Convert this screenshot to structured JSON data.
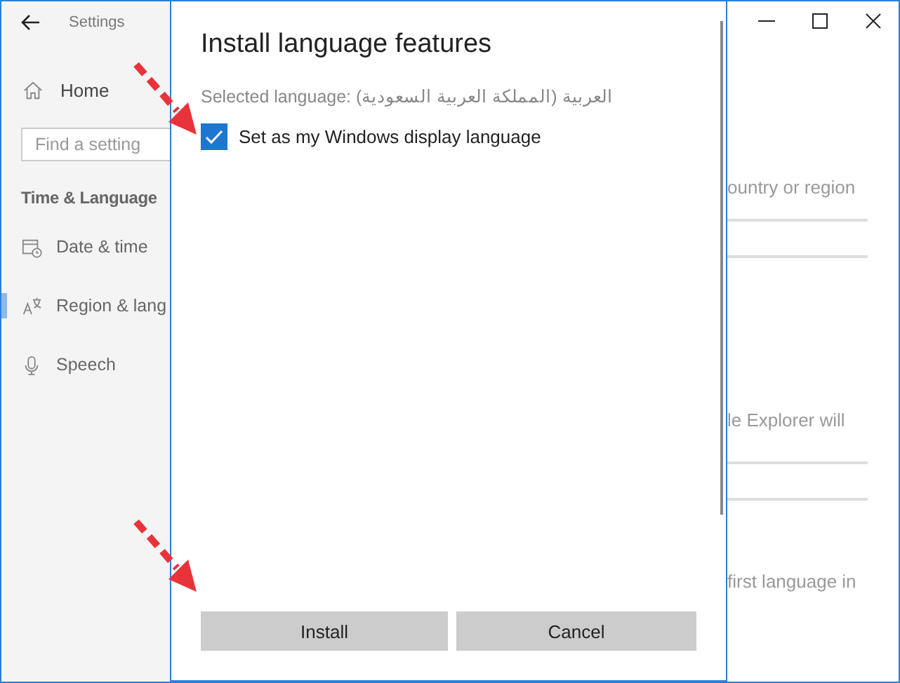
{
  "window": {
    "title": "Settings"
  },
  "sidebar": {
    "home": "Home",
    "search": {
      "placeholder": "Find a setting"
    },
    "section_title": "Time & Language",
    "items": [
      {
        "label": "Date & time",
        "selected": false
      },
      {
        "label": "Region & lang",
        "selected": true
      },
      {
        "label": "Speech",
        "selected": false
      }
    ]
  },
  "main": {
    "texts": [
      "ountry or region",
      "le Explorer will",
      "first language in"
    ]
  },
  "dialog": {
    "title": "Install language features",
    "selected_language": "Selected language: العربية (المملكة العربية السعودية)",
    "checkbox": {
      "label": "Set as my Windows display language",
      "checked": true
    },
    "buttons": [
      {
        "label": "Install"
      },
      {
        "label": "Cancel"
      }
    ]
  }
}
